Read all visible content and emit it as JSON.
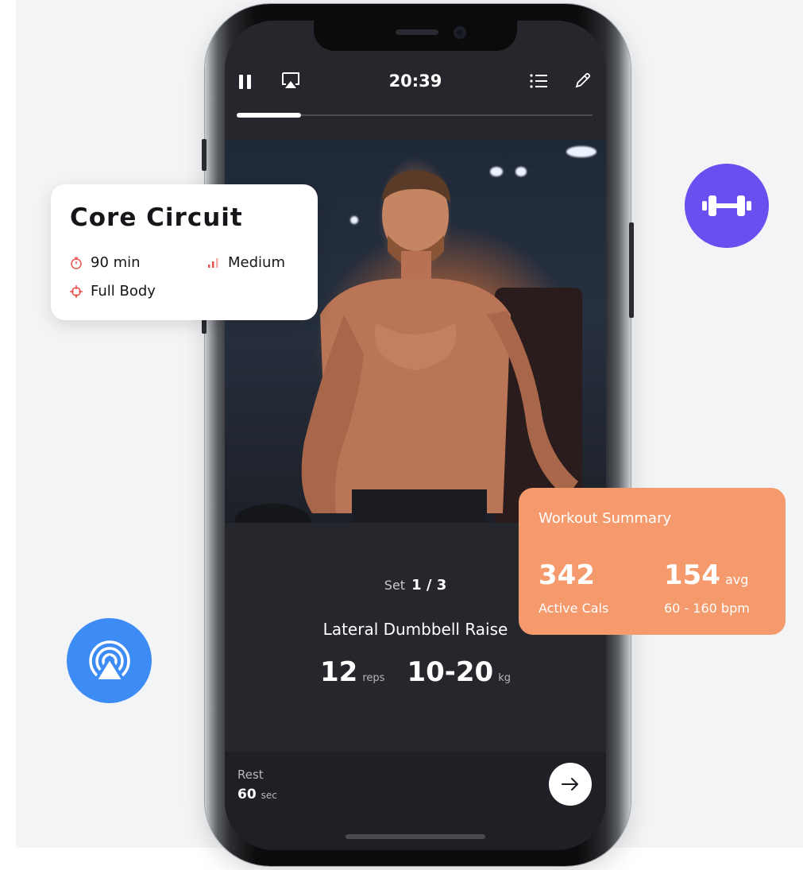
{
  "player": {
    "time": "20:39",
    "progress_fraction": 0.18,
    "set_label": "Set",
    "set_value": "1 / 3",
    "exercise_name": "Lateral Dumbbell Raise",
    "reps_value": "12",
    "reps_unit": "reps",
    "weight_value": "10-20",
    "weight_unit": "kg",
    "rest_label": "Rest",
    "rest_value": "60",
    "rest_unit": "sec",
    "icons": [
      "pause-icon",
      "airplay-icon",
      "list-icon",
      "pencil-icon",
      "arrow-right-icon"
    ]
  },
  "workout_card": {
    "title": "Core Circuit",
    "duration": "90 min",
    "difficulty": "Medium",
    "focus": "Full Body",
    "icons": [
      "timer-icon",
      "signal-bars-icon",
      "crosshair-icon"
    ],
    "accent_color": "#e9524a"
  },
  "summary_card": {
    "title": "Workout Summary",
    "calories_value": "342",
    "calories_label": "Active Cals",
    "heart_value": "154",
    "heart_unit": "avg",
    "heart_range": "60 - 160 bpm",
    "color": "#f49a6c"
  },
  "badges": {
    "dumbbell_color": "#6b4ef0",
    "airdrop_color": "#3d8cf5",
    "icons": [
      "dumbbell-icon",
      "airdrop-icon"
    ]
  }
}
